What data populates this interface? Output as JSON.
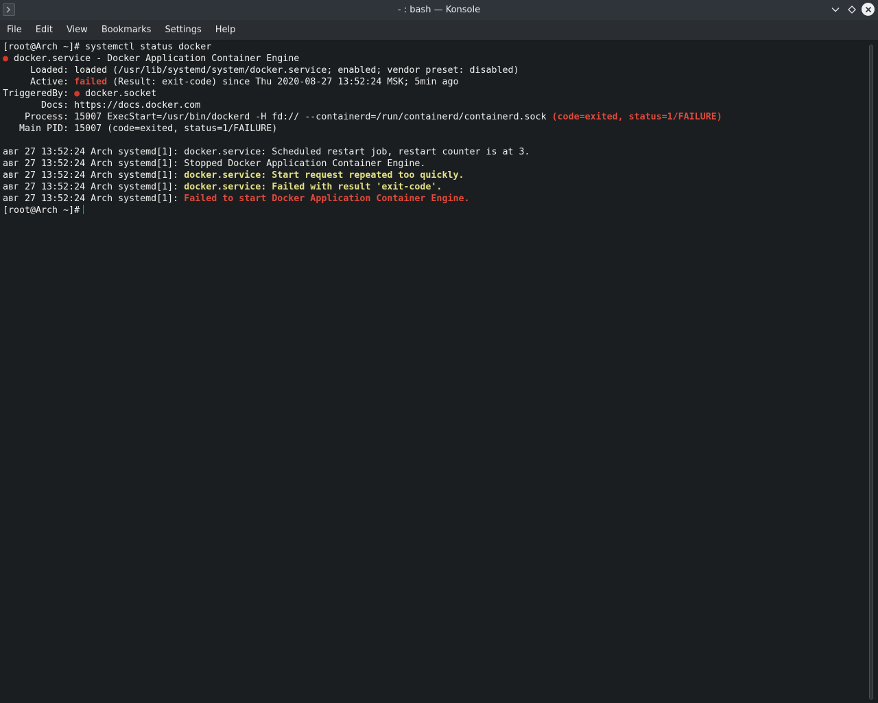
{
  "window": {
    "title": "- : bash — Konsole",
    "icon": "terminal-icon"
  },
  "menu": {
    "items": [
      "File",
      "Edit",
      "View",
      "Bookmarks",
      "Settings",
      "Help"
    ]
  },
  "colors": {
    "background": "#1b1e20",
    "text": "#f0f0f0",
    "error_red": "#d0392b",
    "warning_yellow": "#e4e086"
  },
  "terminal": {
    "prompt": "[root@Arch ~]#",
    "command": " systemctl status docker",
    "unit_line": " docker.service - Docker Application Container Engine",
    "loaded": "     Loaded: loaded (/usr/lib/systemd/system/docker.service; enabled; vendor preset: disabled)",
    "active_label": "     Active: ",
    "active_state": "failed",
    "active_rest": " (Result: exit-code) since Thu 2020-08-27 13:52:24 MSK; 5min ago",
    "triggered_label": "TriggeredBy: ",
    "triggered_value": " docker.socket",
    "docs": "       Docs: https://docs.docker.com",
    "process_main": "    Process: 15007 ExecStart=/usr/bin/dockerd -H fd:// --containerd=/run/containerd/containerd.sock ",
    "process_status": "(code=exited, status=1/FAILURE)",
    "main_pid": "   Main PID: 15007 (code=exited, status=1/FAILURE)",
    "log_prefix": "авг 27 13:52:24 Arch systemd[1]: ",
    "log1": "docker.service: Scheduled restart job, restart counter is at 3.",
    "log2": "Stopped Docker Application Container Engine.",
    "log3": "docker.service: Start request repeated too quickly.",
    "log4": "docker.service: Failed with result 'exit-code'.",
    "log5": "Failed to start Docker Application Container Engine.",
    "dot_glyph": "●"
  }
}
